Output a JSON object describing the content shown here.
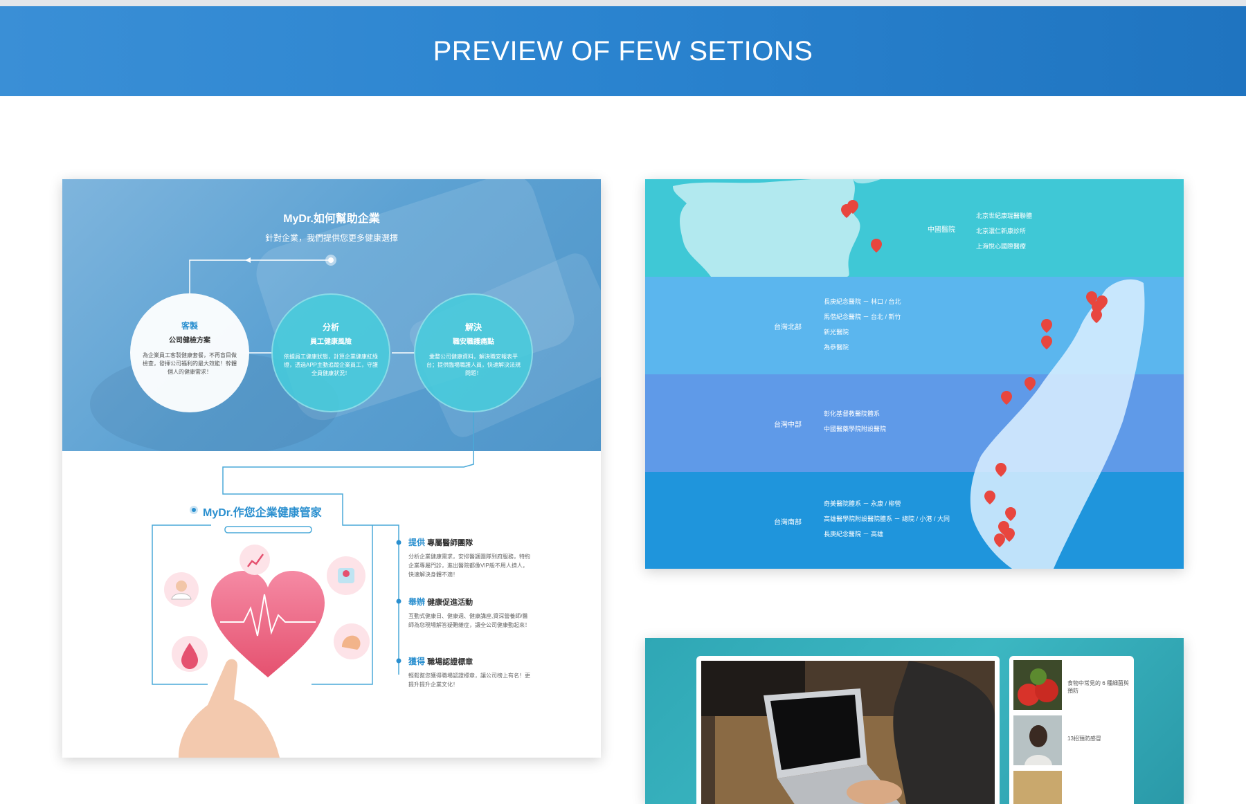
{
  "header": {
    "title": "PREVIEW OF FEW SETIONS"
  },
  "section1": {
    "title": "MyDr.如何幫助企業",
    "subtitle": "針對企業，我們提供您更多健康選擇",
    "circles": [
      {
        "title": "客製",
        "subtitle": "公司健檢方案",
        "desc": "為企業員工客製健康套餐，不再盲目做檢查，發揮公司福利的最大效能！幹體個人的健康需求！"
      },
      {
        "title": "分析",
        "subtitle": "員工健康風險",
        "desc": "依據員工健康狀態，計算企業健康紅綠燈，透過APP主動追蹤企業員工，守護全員健康狀況！"
      },
      {
        "title": "解決",
        "subtitle": "職安職護痛點",
        "desc": "彙整公司健康資料，解決職安報表平台；提供臨場職護人員，快速解決法規問題！"
      }
    ],
    "bottom_title": "MyDr.作您企業健康管家",
    "items": [
      {
        "highlight": "提供",
        "title": "專屬醫師團隊",
        "desc": "分析企業健康需求，安排醫護團隊到府服務，特約企業專屬門診，進出醫院都像VIP般不用人擠人，快速解決身體不適！"
      },
      {
        "highlight": "舉辦",
        "title": "健康促進活動",
        "desc": "互動式健康日、健康週、健康講座,資深營養師/醫師為您現場解答疑難雜症，讓全公司健康動起來！"
      },
      {
        "highlight": "獲得",
        "title": "職場認證標章",
        "desc": "輕鬆幫您獲得職場認證標章，讓公司榜上有名！更提升提升企業文化！"
      }
    ]
  },
  "section2": {
    "colors": {
      "band1": "#3fc8d6",
      "band2": "#5bb6ee",
      "band3": "#5f9ae8",
      "band4": "#1f95dc"
    },
    "bands": [
      {
        "label": "中國醫院",
        "hospitals": [
          "北京世紀康瑞醫聯體",
          "北京濃仁新康診所",
          "上海悅心國際醫療"
        ]
      },
      {
        "label": "台灣北部",
        "hospitals": [
          "長庚紀念醫院 － 林口 / 台北",
          "馬偕紀念醫院 － 台北 / 新竹",
          "新光醫院",
          "為恭醫院"
        ]
      },
      {
        "label": "台灣中部",
        "hospitals": [
          "彰化基督教醫院體系",
          "中國醫藥學院附設醫院"
        ]
      },
      {
        "label": "台灣南部",
        "hospitals": [
          "奇美醫院體系 － 永康 / 柳營",
          "高雄醫學院附設醫院體系 － 總院 / 小港 / 大同",
          "長庚紀念醫院 － 高雄"
        ]
      }
    ]
  },
  "section3": {
    "articles": [
      {
        "title": "食物中常見的 6 種細菌與預防"
      },
      {
        "title": "13招預防感冒"
      }
    ]
  }
}
